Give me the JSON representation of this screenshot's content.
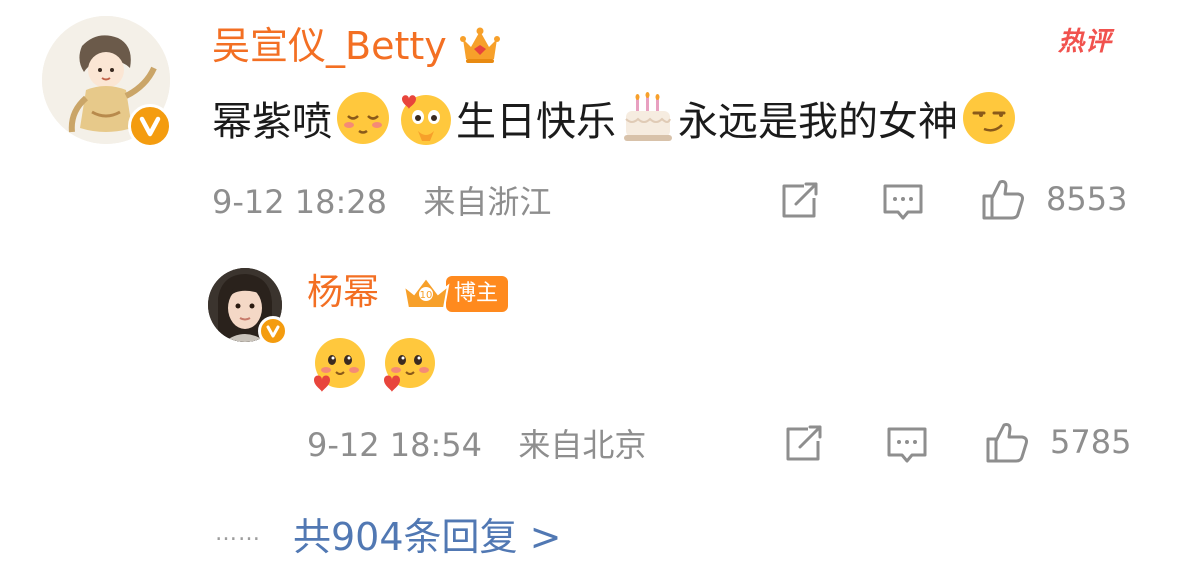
{
  "main_comment": {
    "author": "吴宣仪_Betty",
    "badge_tag": "热评",
    "text_parts": [
      "幂紫喷",
      "生日快乐",
      " 永远是我的女神"
    ],
    "emojis": [
      "shy-face-emoji",
      "heart-eyes-emoji",
      "birthday-cake-emoji",
      "smirk-emoji"
    ],
    "time": "9-12 18:28",
    "location": "来自浙江",
    "likes": "8553"
  },
  "reply": {
    "author": "杨幂",
    "role_badge": "博主",
    "emojis": [
      "love-face-emoji",
      "love-face-emoji"
    ],
    "time": "9-12 18:54",
    "location": "来自北京",
    "likes": "5785"
  },
  "more_replies": {
    "dots": "……",
    "label": "共904条回复 >"
  },
  "colors": {
    "name": "#f36f23",
    "meta": "#8e8e8e",
    "link": "#5178b3",
    "hot": "#f1524e",
    "verified": "#f49c0f"
  }
}
